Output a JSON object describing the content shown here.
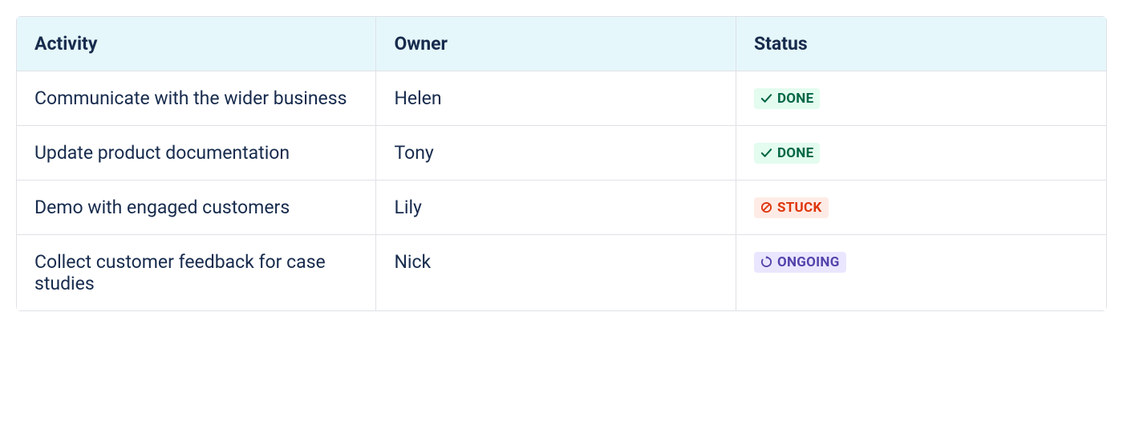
{
  "table": {
    "headers": {
      "activity": "Activity",
      "owner": "Owner",
      "status": "Status"
    },
    "rows": [
      {
        "activity": "Communicate with the wider business",
        "owner": "Helen",
        "status": {
          "label": "DONE",
          "type": "done",
          "icon": "check-icon"
        }
      },
      {
        "activity": "Update product documentation",
        "owner": "Tony",
        "status": {
          "label": "DONE",
          "type": "done",
          "icon": "check-icon"
        }
      },
      {
        "activity": "Demo with engaged customers",
        "owner": "Lily",
        "status": {
          "label": "STUCK",
          "type": "stuck",
          "icon": "prohibited-icon"
        }
      },
      {
        "activity": "Collect customer feedback for case studies",
        "owner": "Nick",
        "status": {
          "label": "ONGOING",
          "type": "ongoing",
          "icon": "refresh-icon"
        }
      }
    ]
  },
  "colors": {
    "header_bg": "#e6f7fb",
    "text": "#172b4d",
    "border": "#dfe1e6",
    "done_bg": "#e3fcef",
    "done_fg": "#006644",
    "stuck_bg": "#ffebe6",
    "stuck_fg": "#de350b",
    "ongoing_bg": "#eae6ff",
    "ongoing_fg": "#5243aa"
  }
}
